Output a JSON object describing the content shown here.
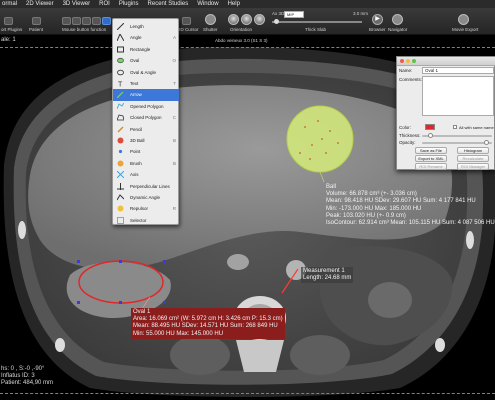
{
  "menubar": {
    "items": [
      "ormal",
      "2D Viewer",
      "3D Viewer",
      "ROI",
      "Plugins",
      "Recent Studies",
      "Window",
      "Help"
    ]
  },
  "toolbar": {
    "labels": [
      "ort Plugins",
      "Patient",
      "Mouse button function",
      "3D Cursor",
      "Shutter",
      "Orientation",
      "Thick Slab",
      "Browser",
      "Navigator",
      "Movie Export"
    ],
    "wl_label": "WL/WW: Soft Tissue",
    "thick_value": "Ax 3D",
    "thick_mode": "MIP",
    "thick_size": "3.0 mm",
    "slice_counter": "150 / 301"
  },
  "viewer": {
    "window_title": "Abdo veineux 3.0 (S1 S 3)",
    "bottom_left": [
      "hs: 0 ,  S:-0 ,-90°",
      "Inflatus  ID: 3",
      "Patient: 484,90 mm"
    ],
    "left_info": [
      "ale: 1"
    ]
  },
  "arrow_note": {
    "title": "Measurement 1",
    "length": "Length: 24.68 mm"
  },
  "ball_note": {
    "lines": [
      "Ball",
      "Volume: 66.878 cm³ (+- 3.036 cm)",
      "Mean: 98.418 HU SDev: 29.607 HU Sum: 4  177  841 HU",
      "Min: -173.000 HU Max: 185.000 HU",
      "Peak: 103.020 HU (+- 0.9 cm)",
      "IsoContour: 62.914 cm³ Mean: 105.115 HU Sum: 4  087  506 HU"
    ]
  },
  "oval_note": {
    "lines": [
      "Oval 1",
      "Area: 16.069 cm² (W: 5.972 cm H: 3.426 cm P: 15.3 cm)",
      "Mean: 88.495 HU SDev: 14.571 HU Sum: 268  849 HU",
      "Min: 55.000 HU Max: 145.000 HU"
    ]
  },
  "tool_menu": {
    "items": [
      {
        "label": "Length",
        "shortcut": "",
        "icon": "length-icon"
      },
      {
        "label": "Angle",
        "shortcut": "A",
        "icon": "angle-icon"
      },
      {
        "label": "Rectangle",
        "shortcut": "",
        "icon": "rectangle-icon"
      },
      {
        "label": "Oval",
        "shortcut": "O",
        "icon": "oval-icon"
      },
      {
        "label": "Oval & Angle",
        "shortcut": "",
        "icon": "oval-angle-icon"
      },
      {
        "label": "Text",
        "shortcut": "T",
        "icon": "text-icon"
      },
      {
        "label": "Arrow",
        "shortcut": "",
        "icon": "arrow-icon"
      },
      {
        "label": "Opened Polygon",
        "shortcut": "",
        "icon": "opened-polygon-icon"
      },
      {
        "label": "Closed Polygon",
        "shortcut": "C",
        "icon": "closed-polygon-icon"
      },
      {
        "label": "Pencil",
        "shortcut": "",
        "icon": "pencil-icon"
      },
      {
        "label": "3D Ball",
        "shortcut": "B",
        "icon": "ball-icon"
      },
      {
        "label": "Point",
        "shortcut": "",
        "icon": "point-icon"
      },
      {
        "label": "Brush",
        "shortcut": "B",
        "icon": "brush-icon"
      },
      {
        "label": "Axis",
        "shortcut": "",
        "icon": "axis-icon"
      },
      {
        "label": "Perpendicular Lines",
        "shortcut": "",
        "icon": "perpendicular-icon"
      },
      {
        "label": "Dynamic Angle",
        "shortcut": "",
        "icon": "dynamic-angle-icon"
      },
      {
        "label": "Repulsor",
        "shortcut": "R",
        "icon": "repulsor-icon"
      },
      {
        "label": "Selector",
        "shortcut": "",
        "icon": "selector-icon"
      }
    ],
    "selected": "Arrow"
  },
  "roi_panel": {
    "name_label": "Name:",
    "name_value": "Oval 1",
    "comments_label": "Comments:",
    "color_label": "Color:",
    "color_value": "#e0282a",
    "all_same_name": "All with same name",
    "thickness_label": "Thickness:",
    "opacity_label": "Opacity:",
    "buttons": [
      "Save as File",
      "Histogram",
      "Export to XML",
      "Recalculate",
      "ROI Rename",
      "ROI Manager"
    ]
  },
  "colors": {
    "oval_roi": "#e0282a",
    "ball_roi": "#d8ef7a",
    "arrow_roi": "#ff3b30",
    "note_bg": "#8c1d1d",
    "menu_selection": "#3d78d8"
  }
}
